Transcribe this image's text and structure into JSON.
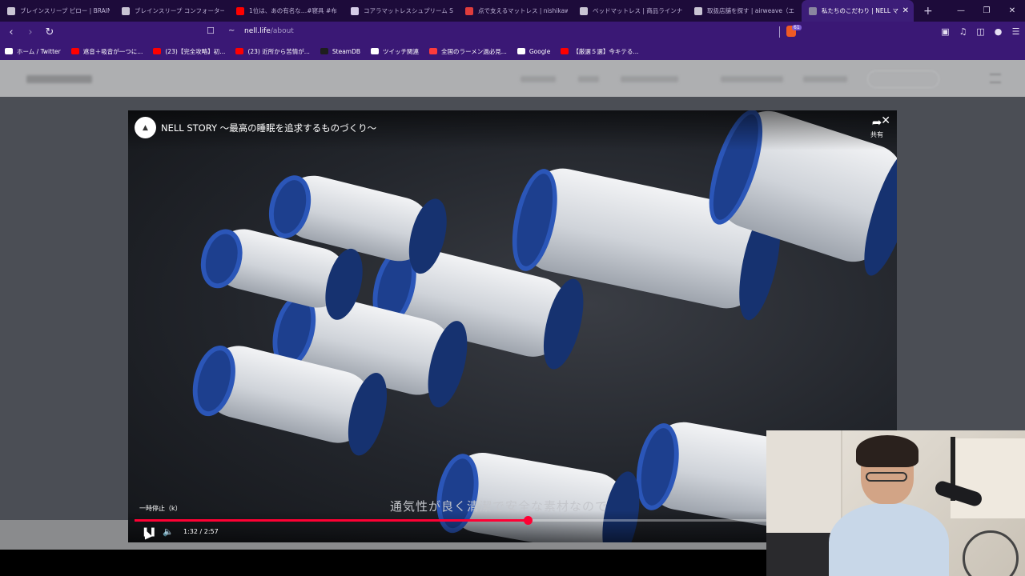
{
  "tabs": [
    {
      "title": "ブレインスリープ ピロー | BRAIN SLE",
      "icon_color": "#c9c4d4",
      "icon": "page-icon"
    },
    {
      "title": "ブレインスリープ コンフォーター パーフ",
      "icon_color": "#c9c4d4",
      "icon": "page-icon"
    },
    {
      "title": "1位は、あの有名な…#寝具 #布",
      "icon_color": "#ff0000",
      "icon": "youtube-icon"
    },
    {
      "title": "コアラマットレスシュプリーム SUPREI",
      "icon_color": "#d5cce8",
      "icon": "koala-icon"
    },
    {
      "title": "点で支えるマットレス | nishikawa",
      "icon_color": "#e03c3c",
      "icon": "nishikawa-icon"
    },
    {
      "title": "ベッドマットレス | 商品ラインナップ",
      "icon_color": "#c9c4d4",
      "icon": "page-icon"
    },
    {
      "title": "取扱店舗を探す | airweave（エ",
      "icon_color": "#c9c4d4",
      "icon": "page-icon"
    },
    {
      "title": "私たちのこだわり | NELL マ",
      "icon_color": "#8a86a0",
      "icon": "nell-icon",
      "active": true
    }
  ],
  "address": {
    "domain": "nell.life",
    "path": "/about",
    "brave_badge": "61"
  },
  "bookmarks": [
    {
      "label": "ホーム / Twitter",
      "icon": "x-icon",
      "color": "#ffffff"
    },
    {
      "label": "遮音＋吸音が一つに...",
      "icon": "youtube-icon",
      "color": "#ff0000"
    },
    {
      "label": "(23)【完全攻略】初...",
      "icon": "youtube-icon",
      "color": "#ff0000"
    },
    {
      "label": "(23) 近所から苦情が...",
      "icon": "youtube-icon",
      "color": "#ff0000"
    },
    {
      "label": "SteamDB",
      "icon": "steamdb-icon",
      "color": "#1e1e1e"
    },
    {
      "label": "ツイッチ関連",
      "icon": "folder-icon",
      "color": "#ffffff"
    },
    {
      "label": "全国のラーメン過必見...",
      "icon": "ramen-icon",
      "color": "#ff3b3b"
    },
    {
      "label": "Google",
      "icon": "google-icon",
      "color": "#ffffff"
    },
    {
      "label": "【厳選５選】今キテる...",
      "icon": "youtube-icon",
      "color": "#ff0000"
    }
  ],
  "video": {
    "title": "NELL STORY 〜最高の睡眠を追求するものづくり〜",
    "share_label": "共有",
    "subtitle": "通気性が良く清潔で安全な素材なので",
    "tooltip": "一時停止（k）",
    "timecode": "1:32 / 2:57",
    "progress": 0.52,
    "accent": "#ff0033"
  }
}
